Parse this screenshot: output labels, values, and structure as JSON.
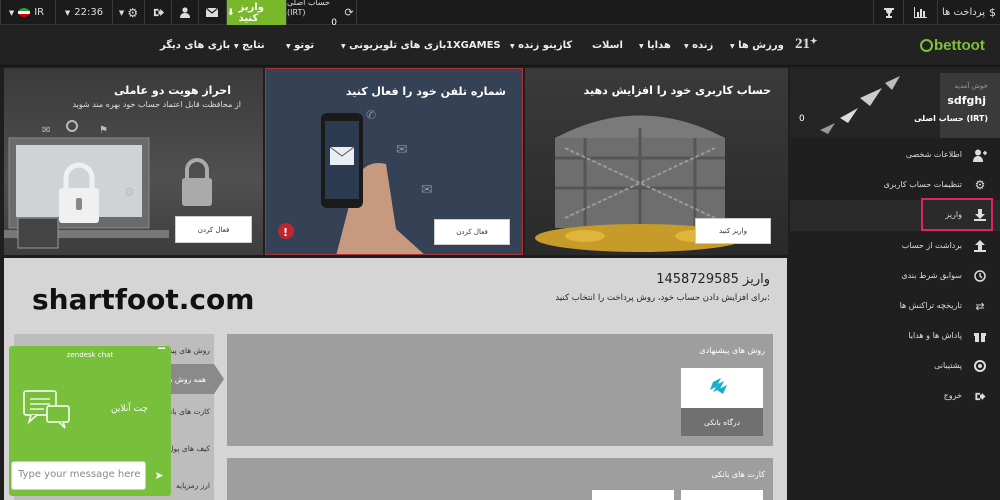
{
  "topbar": {
    "lang": "IR",
    "time": "22:36",
    "account_label": "حساب اصلی (IRT)",
    "account_balance": "0",
    "deposit_label": "واریز کنید",
    "payments_label": "پرداخت ها"
  },
  "nav": {
    "logo_text": "bettoot",
    "twenty_one": "21",
    "items": [
      "ورزش ها",
      "زنده",
      "هدایا",
      "اسلات",
      "کازینو زنده",
      "1XGAMES",
      "بازی های تلویزیونی",
      "توتو",
      "نتایج",
      "بازی های دیگر"
    ]
  },
  "banners": {
    "b1": {
      "title": "حساب کاربری خود را افزایش دهید",
      "button": "واریز کنید"
    },
    "b2": {
      "title": "شماره تلفن خود را فعال کنید",
      "button": "فعال کردن"
    },
    "b3": {
      "title": "احراز هویت دو عاملی",
      "subtitle": "از محافظت قابل اعتماد حساب خود بهره مند شوید",
      "button": "فعال کردن"
    }
  },
  "sidebar": {
    "greeting": "خوش آمدید",
    "username": "sdfghj",
    "account": "حساب اصلی (IRT)",
    "balance": "0",
    "items": [
      {
        "label": "اطلاعات شخصی",
        "icon": "user-plus-icon"
      },
      {
        "label": "تنظیمات حساب کاربری",
        "icon": "gears-icon"
      },
      {
        "label": "واریز",
        "icon": "download-icon"
      },
      {
        "label": "برداشت از حساب",
        "icon": "upload-icon"
      },
      {
        "label": "سوابق شرط بندی",
        "icon": "clock-icon"
      },
      {
        "label": "تاریخچه تراکنش ها",
        "icon": "transfer-icon"
      },
      {
        "label": "پاداش ها و هدایا",
        "icon": "gift-icon"
      },
      {
        "label": "پشتیبانی",
        "icon": "support-icon"
      },
      {
        "label": "خروج",
        "icon": "exit-icon"
      }
    ]
  },
  "content": {
    "title": "واریز 1458729585",
    "subtitle": "برای افزایش دادن حساب خود، روش پرداخت را انتخاب کنید:",
    "watermark": "shartfoot.com",
    "left_menu": [
      "روش های پیشنهادی",
      "همه روش ها",
      "کارت های بانکی",
      "کیف های پول",
      "ارز رمزپایه"
    ],
    "panel1_title": "روش های پیشنهادی",
    "panel1_card_label": "درگاه بانکی",
    "panel2_title": "کارت های بانکی"
  },
  "chat": {
    "header": "zendesk chat",
    "online": "چت آنلاین",
    "placeholder": "Type your message here"
  },
  "colors": {
    "brand_green": "#79b82b",
    "highlight": "#e0245e"
  }
}
